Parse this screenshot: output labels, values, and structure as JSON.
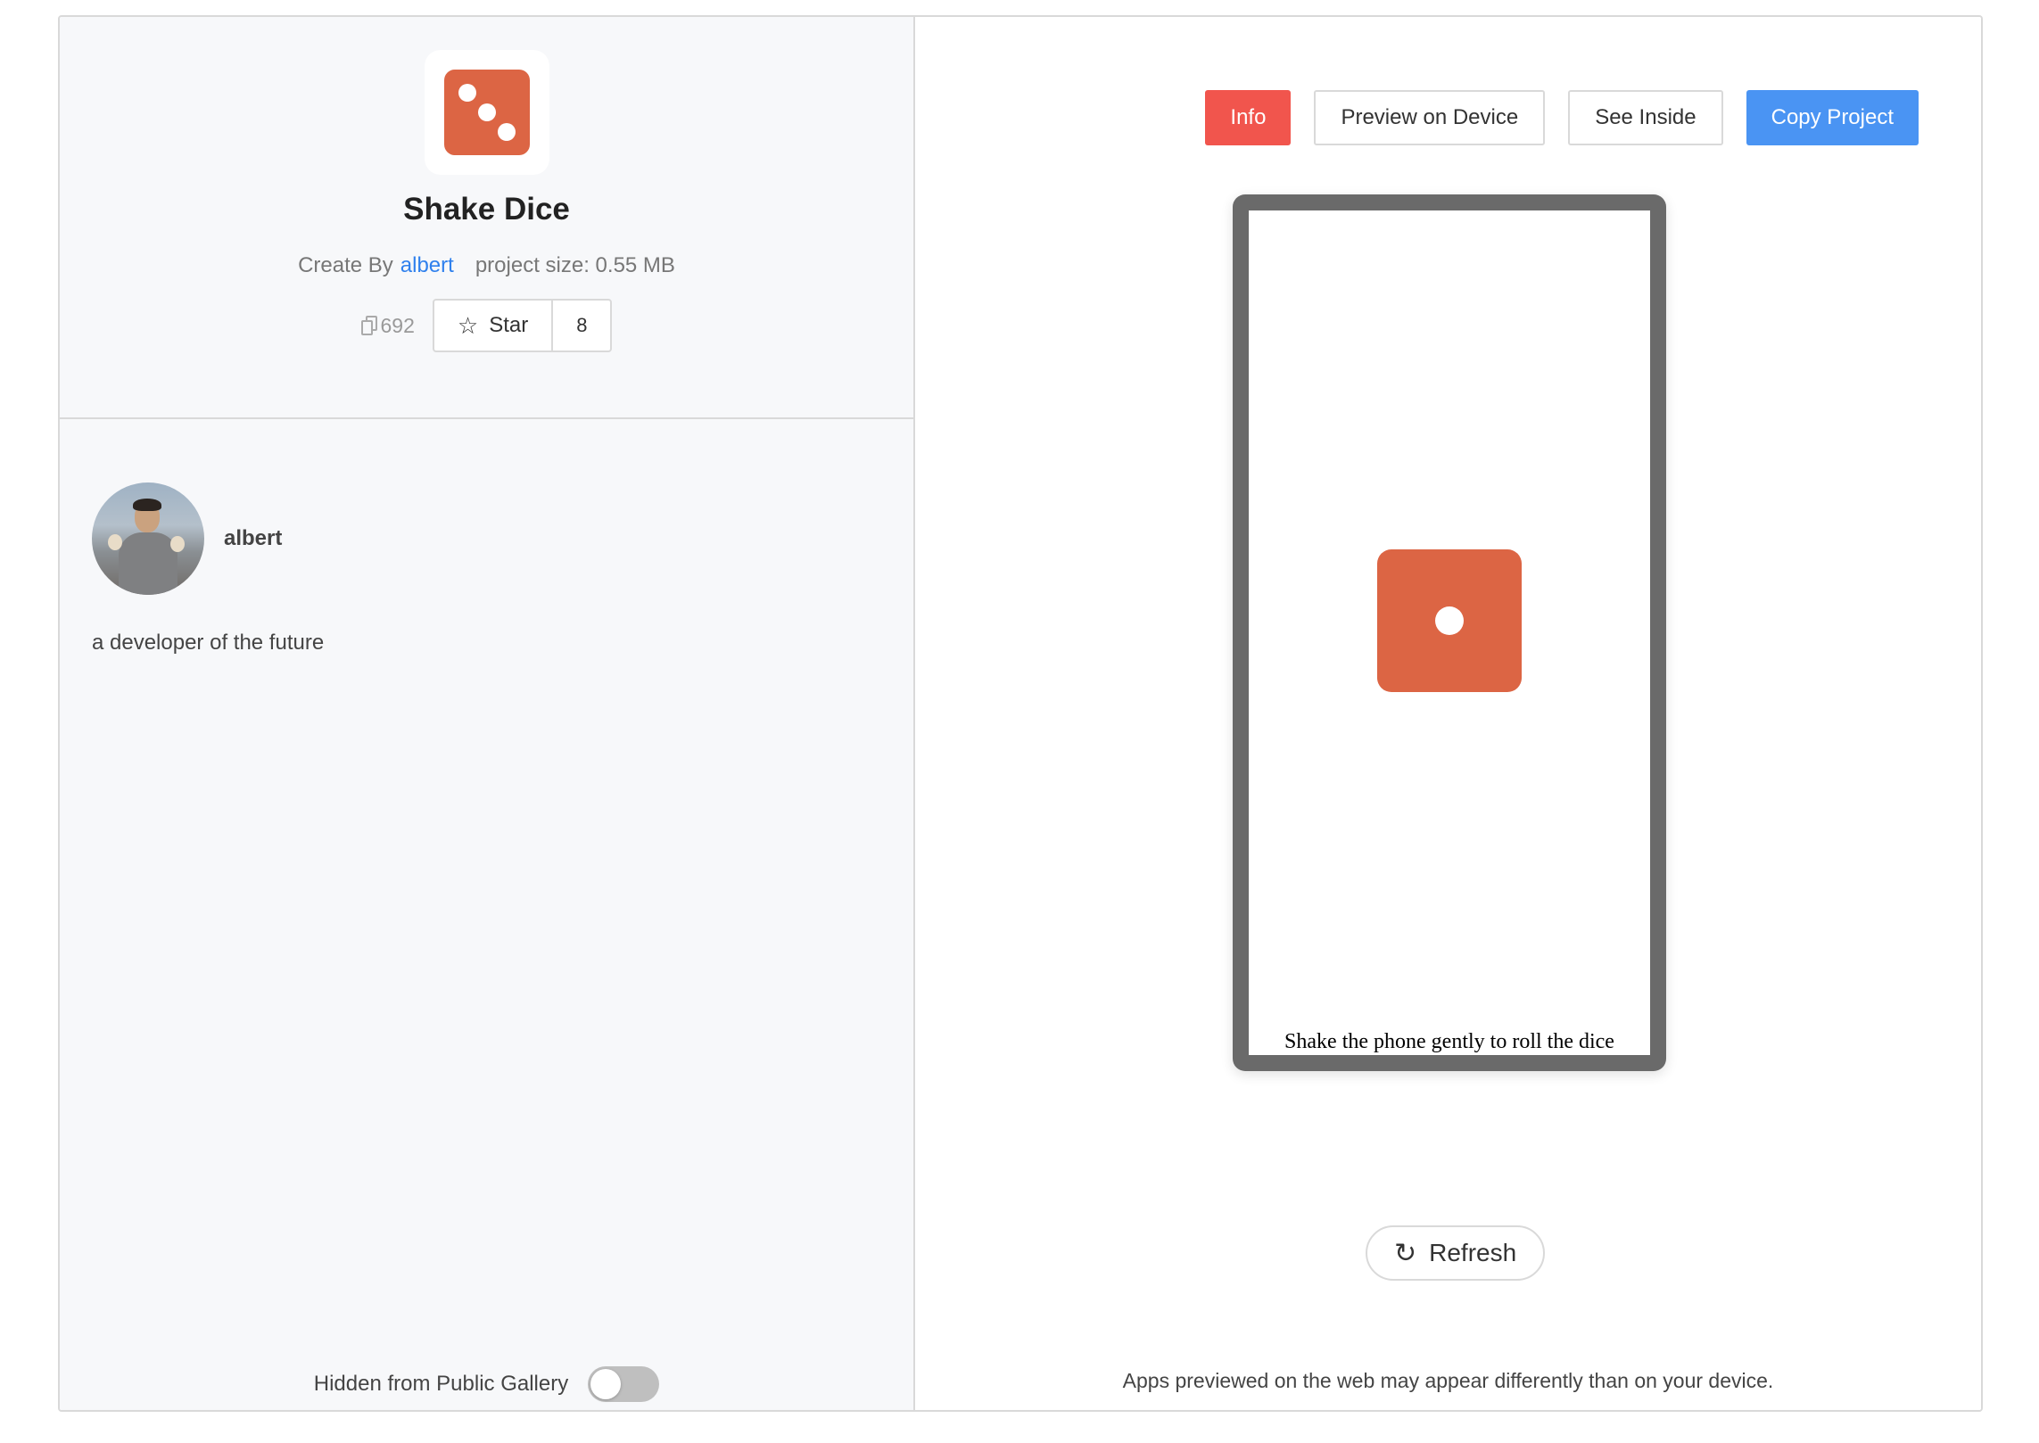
{
  "project": {
    "title": "Shake Dice",
    "created_by_label": "Create By",
    "author": "albert",
    "project_size": "project size: 0.55 MB",
    "copies": "692",
    "star_label": "Star",
    "star_count": "8",
    "icon": "dice-three-icon",
    "accent_color": "#dc6544"
  },
  "profile": {
    "name": "albert",
    "bio": "a developer of the future"
  },
  "gallery": {
    "hidden_label": "Hidden from Public Gallery",
    "hidden_toggle_on": false
  },
  "actions": {
    "info": "Info",
    "preview": "Preview on Device",
    "see_inside": "See Inside",
    "copy": "Copy Project"
  },
  "preview": {
    "hint": "Shake the phone gently to roll the dice",
    "die_face": 1,
    "refresh": "Refresh",
    "note": "Apps previewed on the web may appear differently than on your device."
  },
  "colors": {
    "info_button": "#f1554d",
    "primary_button": "#4a94f3",
    "link": "#2f80ed"
  }
}
